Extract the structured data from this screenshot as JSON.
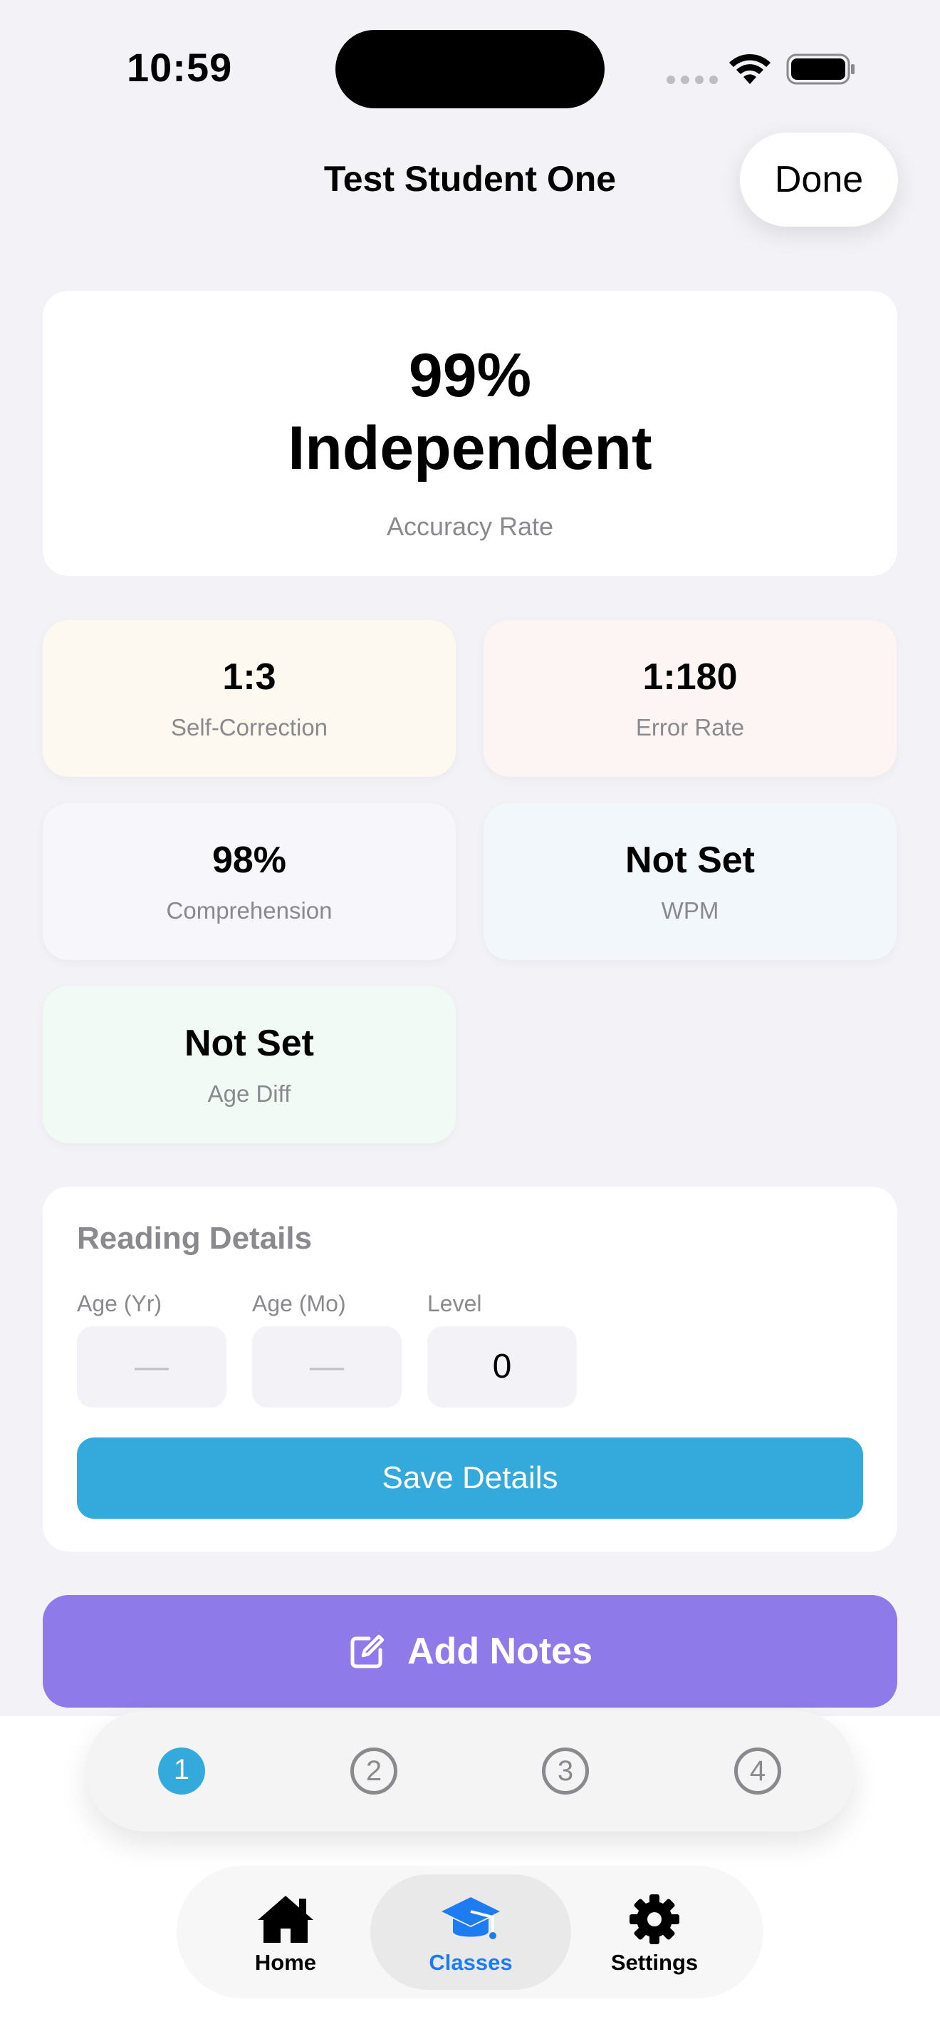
{
  "status_bar": {
    "time": "10:59"
  },
  "nav": {
    "title": "Test Student One",
    "done_label": "Done"
  },
  "accuracy": {
    "value": "99%",
    "level": "Independent",
    "label": "Accuracy Rate"
  },
  "stats": [
    {
      "value": "1:3",
      "label": "Self-Correction"
    },
    {
      "value": "1:180",
      "label": "Error Rate"
    },
    {
      "value": "98%",
      "label": "Comprehension"
    },
    {
      "value": "Not Set",
      "label": "WPM"
    },
    {
      "value": "Not Set",
      "label": "Age Diff"
    }
  ],
  "reading_details": {
    "title": "Reading Details",
    "fields": [
      {
        "label": "Age (Yr)",
        "value": "—"
      },
      {
        "label": "Age (Mo)",
        "value": "—"
      },
      {
        "label": "Level",
        "value": "0"
      }
    ],
    "save_label": "Save Details"
  },
  "notes": {
    "label": "Add Notes",
    "icon": "square-pencil-icon"
  },
  "pager": {
    "pages": [
      "1",
      "2",
      "3",
      "4"
    ],
    "selected": "1",
    "accent": "#34aadc"
  },
  "tabbar": {
    "tabs": [
      {
        "label": "Home",
        "icon": "house-icon"
      },
      {
        "label": "Classes",
        "icon": "graduation-cap-icon"
      },
      {
        "label": "Settings",
        "icon": "gear-icon"
      }
    ],
    "selected": "Classes",
    "accent": "#1e7cf2"
  },
  "colors": {
    "save_button": "#34aadc",
    "notes_button": "#8e7ae9"
  }
}
